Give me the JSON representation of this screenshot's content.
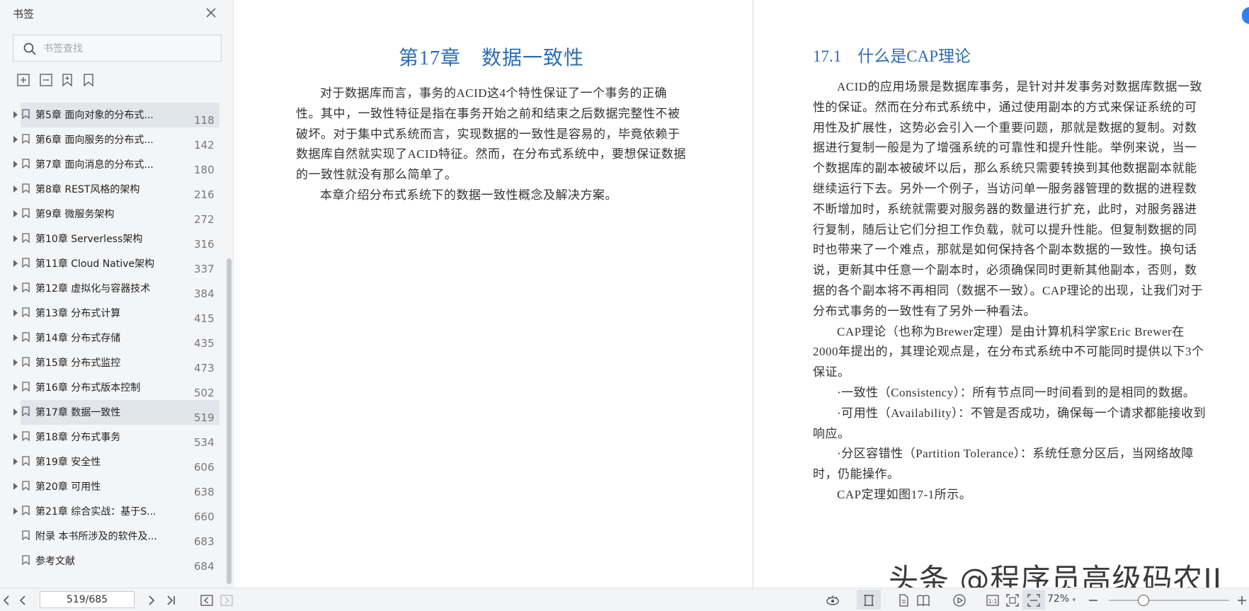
{
  "sidebar": {
    "title": "书签",
    "search_placeholder": "书签查找",
    "items": [
      {
        "label": "第5章 面向对象的分布式...",
        "page": "118",
        "expandable": true,
        "selected": true
      },
      {
        "label": "第6章 面向服务的分布式...",
        "page": "142",
        "expandable": true
      },
      {
        "label": "第7章 面向消息的分布式...",
        "page": "180",
        "expandable": true
      },
      {
        "label": "第8章 REST风格的架构",
        "page": "216",
        "expandable": true
      },
      {
        "label": "第9章 微服务架构",
        "page": "272",
        "expandable": true
      },
      {
        "label": "第10章 Serverless架构",
        "page": "316",
        "expandable": true
      },
      {
        "label": "第11章 Cloud Native架构",
        "page": "337",
        "expandable": true
      },
      {
        "label": "第12章 虚拟化与容器技术",
        "page": "384",
        "expandable": true
      },
      {
        "label": "第13章 分布式计算",
        "page": "415",
        "expandable": true
      },
      {
        "label": "第14章 分布式存储",
        "page": "435",
        "expandable": true
      },
      {
        "label": "第15章 分布式监控",
        "page": "473",
        "expandable": true
      },
      {
        "label": "第16章 分布式版本控制",
        "page": "502",
        "expandable": true
      },
      {
        "label": "第17章 数据一致性",
        "page": "519",
        "expandable": true,
        "selected": true
      },
      {
        "label": "第18章 分布式事务",
        "page": "534",
        "expandable": true
      },
      {
        "label": "第19章 安全性",
        "page": "606",
        "expandable": true
      },
      {
        "label": "第20章 可用性",
        "page": "638",
        "expandable": true
      },
      {
        "label": "第21章 综合实战：基于S...",
        "page": "660",
        "expandable": true
      },
      {
        "label": "附录 本书所涉及的软件及...",
        "page": "683",
        "expandable": false
      },
      {
        "label": "参考文献",
        "page": "684",
        "expandable": false
      }
    ]
  },
  "document": {
    "left_page": {
      "chapter_title": "第17章　数据一致性",
      "paragraphs": [
        "对于数据库而言，事务的ACID这4个特性保证了一个事务的正确性。其中，一致性特征是指在事务开始之前和结束之后数据完整性不被破坏。对于集中式系统而言，实现数据的一致性是容易的，毕竟依赖于数据库自然就实现了ACID特征。然而，在分布式系统中，要想保证数据的一致性就没有那么简单了。",
        "本章介绍分布式系统下的数据一致性概念及解决方案。"
      ]
    },
    "right_page": {
      "section_title": "17.1　什么是CAP理论",
      "paragraphs": [
        "ACID的应用场景是数据库事务，是针对并发事务对数据库数据一致性的保证。然而在分布式系统中，通过使用副本的方式来保证系统的可用性及扩展性，这势必会引入一个重要问题，那就是数据的复制。对数据进行复制一般是为了增强系统的可靠性和提升性能。举例来说，当一个数据库的副本被破坏以后，那么系统只需要转换到其他数据副本就能继续运行下去。另外一个例子，当访问单一服务器管理的数据的进程数不断增加时，系统就需要对服务器的数量进行扩充，此时，对服务器进行复制，随后让它们分担工作负载，就可以提升性能。但复制数据的同时也带来了一个难点，那就是如何保持各个副本数据的一致性。换句话说，更新其中任意一个副本时，必须确保同时更新其他副本，否则，数据的各个副本将不再相同（数据不一致）。CAP理论的出现，让我们对于分布式事务的一致性有了另外一种看法。",
        "CAP理论（也称为Brewer定理）是由计算机科学家Eric Brewer在2000年提出的，其理论观点是，在分布式系统中不可能同时提供以下3个保证。",
        "·一致性（Consistency）：所有节点同一时间看到的是相同的数据。",
        "·可用性（Availability）：不管是否成功，确保每一个请求都能接收到响应。",
        "·分区容错性（Partition Tolerance）：系统任意分区后，当网络故障时，仍能操作。",
        "CAP定理如图17-1所示。"
      ]
    }
  },
  "watermark": "头条 @程序员高级码农II",
  "statusbar": {
    "page_indicator": "519/685",
    "zoom": "72%",
    "zoom_level": 0.29
  },
  "colors": {
    "heading_blue": "#2e6db4",
    "selection_bg": "#e1e5ec",
    "accent_blue": "#2f7ff5"
  }
}
